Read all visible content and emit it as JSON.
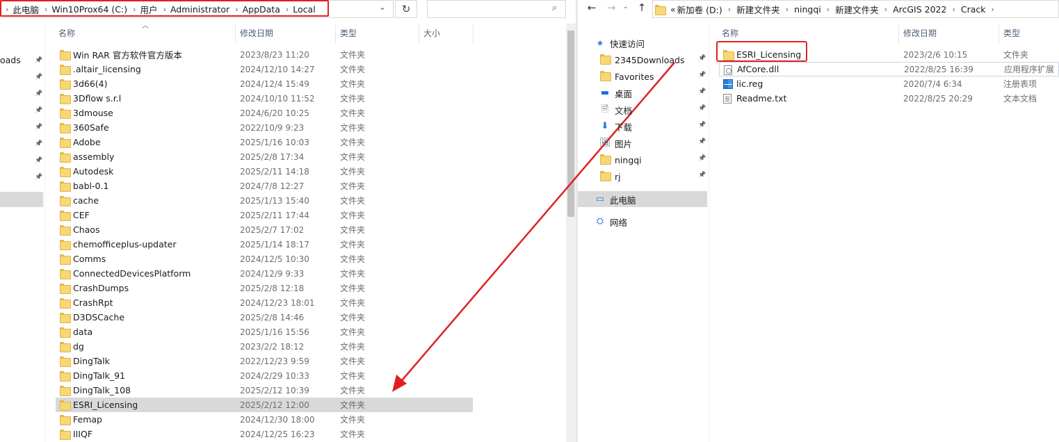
{
  "left_window": {
    "breadcrumbs": [
      "此电脑",
      "Win10Prox64 (C:)",
      "用户",
      "Administrator",
      "AppData",
      "Local"
    ],
    "nav_partial_label": "oads",
    "columns": {
      "name": "名称",
      "date": "修改日期",
      "type": "类型",
      "size": "大小"
    },
    "rows": [
      {
        "name": "Win RAR 官方软件官方版本",
        "date": "2023/8/23 11:20",
        "type": "文件夹"
      },
      {
        "name": ".altair_licensing",
        "date": "2024/12/10 14:27",
        "type": "文件夹"
      },
      {
        "name": "3d66(4)",
        "date": "2024/12/4 15:49",
        "type": "文件夹"
      },
      {
        "name": "3Dflow s.r.l",
        "date": "2024/10/10 11:52",
        "type": "文件夹"
      },
      {
        "name": "3dmouse",
        "date": "2024/6/20 10:25",
        "type": "文件夹"
      },
      {
        "name": "360Safe",
        "date": "2022/10/9 9:23",
        "type": "文件夹"
      },
      {
        "name": "Adobe",
        "date": "2025/1/16 10:03",
        "type": "文件夹"
      },
      {
        "name": "assembly",
        "date": "2025/2/8 17:34",
        "type": "文件夹"
      },
      {
        "name": "Autodesk",
        "date": "2025/2/11 14:18",
        "type": "文件夹"
      },
      {
        "name": "babl-0.1",
        "date": "2024/7/8 12:27",
        "type": "文件夹"
      },
      {
        "name": "cache",
        "date": "2025/1/13 15:40",
        "type": "文件夹"
      },
      {
        "name": "CEF",
        "date": "2025/2/11 17:44",
        "type": "文件夹"
      },
      {
        "name": "Chaos",
        "date": "2025/2/7 17:02",
        "type": "文件夹"
      },
      {
        "name": "chemofficeplus-updater",
        "date": "2025/1/14 18:17",
        "type": "文件夹"
      },
      {
        "name": "Comms",
        "date": "2024/12/5 10:30",
        "type": "文件夹"
      },
      {
        "name": "ConnectedDevicesPlatform",
        "date": "2024/12/9 9:33",
        "type": "文件夹"
      },
      {
        "name": "CrashDumps",
        "date": "2025/2/8 12:18",
        "type": "文件夹"
      },
      {
        "name": "CrashRpt",
        "date": "2024/12/23 18:01",
        "type": "文件夹"
      },
      {
        "name": "D3DSCache",
        "date": "2025/2/8 14:46",
        "type": "文件夹"
      },
      {
        "name": "data",
        "date": "2025/1/16 15:56",
        "type": "文件夹"
      },
      {
        "name": "dg",
        "date": "2023/2/2 18:12",
        "type": "文件夹"
      },
      {
        "name": "DingTalk",
        "date": "2022/12/23 9:59",
        "type": "文件夹"
      },
      {
        "name": "DingTalk_91",
        "date": "2024/2/29 10:33",
        "type": "文件夹"
      },
      {
        "name": "DingTalk_108",
        "date": "2025/2/12 10:39",
        "type": "文件夹"
      },
      {
        "name": "ESRI_Licensing",
        "date": "2025/2/12 12:00",
        "type": "文件夹",
        "selected": true
      },
      {
        "name": "Femap",
        "date": "2024/12/30 18:00",
        "type": "文件夹"
      },
      {
        "name": "IIIQF",
        "date": "2024/12/25 16:23",
        "type": "文件夹"
      }
    ]
  },
  "right_window": {
    "breadcrumbs": [
      "新加卷 (D:)",
      "新建文件夹",
      "ningqi",
      "新建文件夹",
      "ArcGIS 2022",
      "Crack"
    ],
    "overflow_glyph": "«",
    "nav": {
      "quick_access": "快速访问",
      "items": [
        "2345Downloads",
        "Favorites",
        "桌面",
        "文档",
        "下载",
        "图片",
        "ningqi",
        "rj"
      ],
      "this_pc": "此电脑",
      "network": "网络"
    },
    "columns": {
      "name": "名称",
      "date": "修改日期",
      "type": "类型"
    },
    "rows": [
      {
        "name": "ESRI_Licensing",
        "date": "2023/2/6 10:15",
        "type": "文件夹",
        "icon": "folder-icon"
      },
      {
        "name": "AfCore.dll",
        "date": "2022/8/25 16:39",
        "type": "应用程序扩展",
        "icon": "dll-file-icon"
      },
      {
        "name": "lic.reg",
        "date": "2020/7/4 6:34",
        "type": "注册表项",
        "icon": "registry-file-icon"
      },
      {
        "name": "Readme.txt",
        "date": "2022/8/25 20:29",
        "type": "文本文档",
        "icon": "text-file-icon"
      }
    ]
  },
  "colors": {
    "highlight_red": "#e02020",
    "selection_gray": "#d9d9d9",
    "header_text": "#4c607a",
    "folder_yellow": "#f8d775"
  }
}
